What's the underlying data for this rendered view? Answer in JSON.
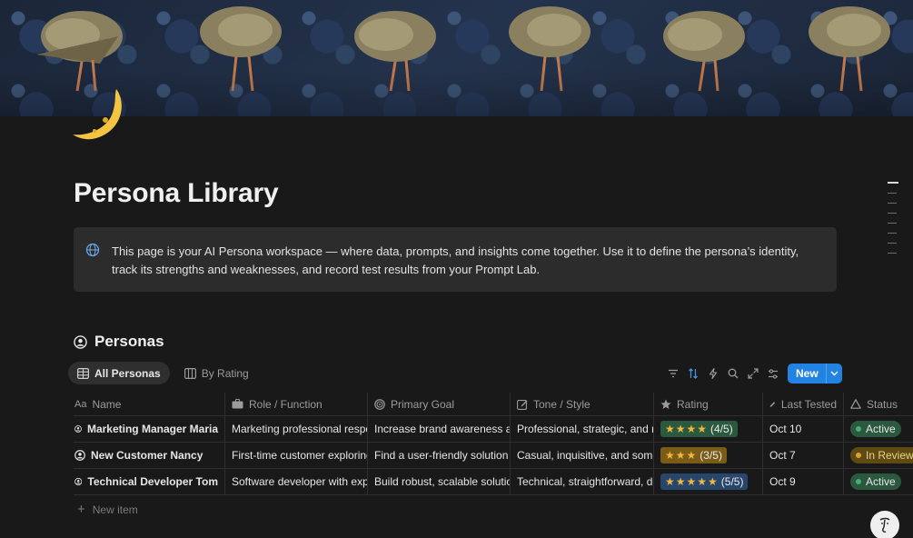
{
  "page": {
    "title": "Persona Library",
    "callout_text": "This page is your AI Persona workspace — where data, prompts, and insights come together. Use it to define the persona’s identity, track its strengths and weaknesses, and record test results from your Prompt Lab."
  },
  "database": {
    "title": "Personas",
    "views": [
      {
        "label": "All Personas",
        "icon": "table-icon",
        "active": true
      },
      {
        "label": "By Rating",
        "icon": "board-icon",
        "active": false
      }
    ],
    "toolbar": {
      "icons": [
        "filter-icon",
        "sort-icon",
        "automation-icon",
        "search-icon",
        "expand-icon",
        "settings-icon"
      ],
      "new_label": "New"
    },
    "columns": [
      {
        "label": "Name",
        "icon": "text-icon"
      },
      {
        "label": "Role / Function",
        "icon": "briefcase-icon"
      },
      {
        "label": "Primary Goal",
        "icon": "target-icon"
      },
      {
        "label": "Tone / Style",
        "icon": "edit-icon"
      },
      {
        "label": "Rating",
        "icon": "star-icon"
      },
      {
        "label": "Last Tested",
        "icon": "pen-icon"
      },
      {
        "label": "Status",
        "icon": "triangle-icon"
      }
    ],
    "rows": [
      {
        "name": "Marketing Manager Maria",
        "role": "Marketing professional respons",
        "goal": "Increase brand awareness and c",
        "tone": "Professional, strategic, and resu",
        "rating_stars": "★★★★",
        "rating_text": "(4/5)",
        "rating_color": "green",
        "last_tested": "Oct 10",
        "status": "Active"
      },
      {
        "name": "New Customer Nancy",
        "role": "First-time customer exploring p",
        "goal": "Find a user-friendly solution tha",
        "tone": "Casual, inquisitive, and sometim",
        "rating_stars": "★★★",
        "rating_text": "(3/5)",
        "rating_color": "amber",
        "last_tested": "Oct 7",
        "status": "In Review"
      },
      {
        "name": "Technical Developer Tom",
        "role": "Software developer with expert",
        "goal": "Build robust, scalable solutions",
        "tone": "Technical, straightforward, deta",
        "rating_stars": "★★★★★",
        "rating_text": "(5/5)",
        "rating_color": "blue",
        "last_tested": "Oct 9",
        "status": "Active"
      }
    ],
    "new_item_label": "New item"
  },
  "colors": {
    "background": "#191919",
    "accent": "#2383e2",
    "status_active": "#2b593f",
    "status_review": "#5e4a12"
  }
}
